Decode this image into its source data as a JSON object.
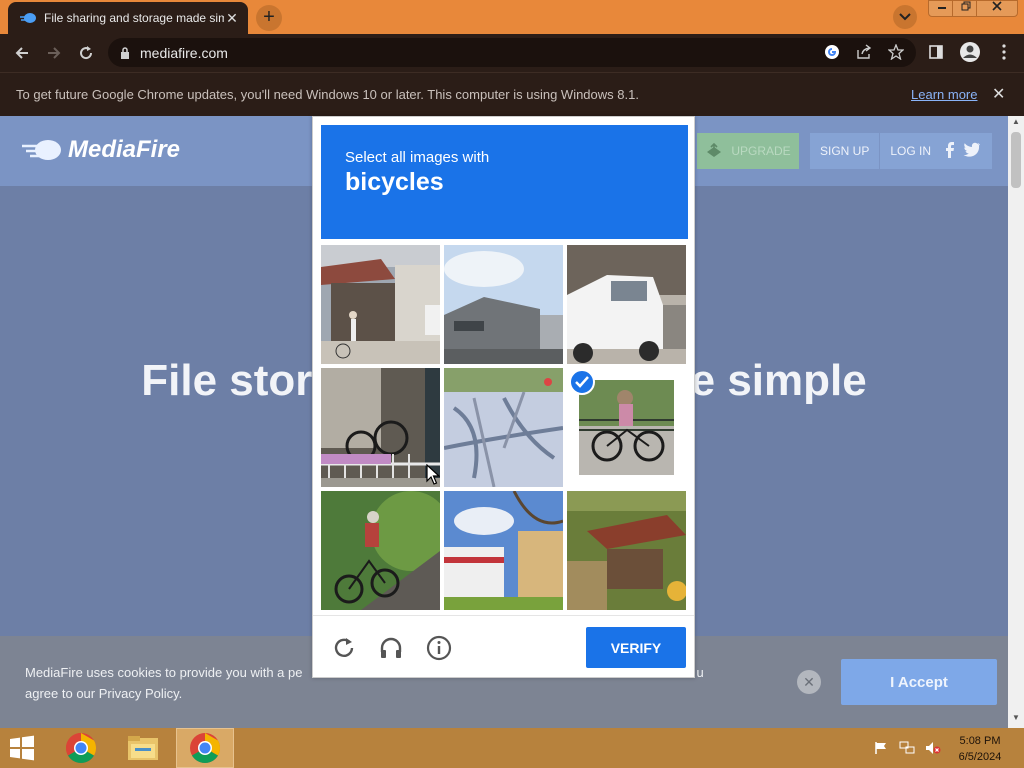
{
  "browser": {
    "tab_title": "File sharing and storage made simple",
    "tab_close": "✕",
    "new_tab": "+",
    "url": "mediafire.com"
  },
  "infobar": {
    "message": "To get future Google Chrome updates, you'll need Windows 10 or later. This computer is using Windows 8.1.",
    "learn_more": "Learn more",
    "close": "✕"
  },
  "site": {
    "logo": "MediaFire",
    "upgrade": "UPGRADE",
    "sign_up": "SIGN UP",
    "log_in": "LOG IN",
    "hero_left": "File storag",
    "hero_right": "de simple"
  },
  "cookie": {
    "text_line1": "MediaFire uses cookies to provide you with a pe",
    "text_line1_end": "u",
    "text_line2": "agree to our Privacy Policy.",
    "accept": "I Accept",
    "dismiss": "✕"
  },
  "captcha": {
    "instruction": "Select all images with",
    "target": "bicycles",
    "verify": "VERIFY",
    "tiles": [
      {
        "scene": "house with person and bicycle",
        "selected": false
      },
      {
        "scene": "grey building under sky",
        "selected": false
      },
      {
        "scene": "white van",
        "selected": false
      },
      {
        "scene": "parked bicycles by railing",
        "selected": false
      },
      {
        "scene": "pavement with tree shadows",
        "selected": false
      },
      {
        "scene": "person riding bicycle",
        "selected": true
      },
      {
        "scene": "person riding bicycle on path",
        "selected": false
      },
      {
        "scene": "street with buildings",
        "selected": false
      },
      {
        "scene": "garden with hut",
        "selected": false
      }
    ]
  },
  "taskbar": {
    "time": "5:08 PM",
    "date": "6/5/2024"
  },
  "colors": {
    "accent_blue": "#1a73e8",
    "chrome_orange": "#e8883a",
    "chrome_dark": "#2b1d17",
    "taskbar": "#b7823d"
  },
  "icons": {
    "back": "arrow-left-icon",
    "forward": "arrow-right-icon",
    "reload": "reload-icon",
    "lock": "lock-icon",
    "google": "google-icon",
    "share": "share-icon",
    "star": "star-icon",
    "sidepanel": "sidepanel-icon",
    "profile": "profile-icon",
    "menu": "kebab-menu-icon",
    "captcha_reload": "refresh-icon",
    "captcha_audio": "headphones-icon",
    "captcha_info": "info-icon"
  }
}
